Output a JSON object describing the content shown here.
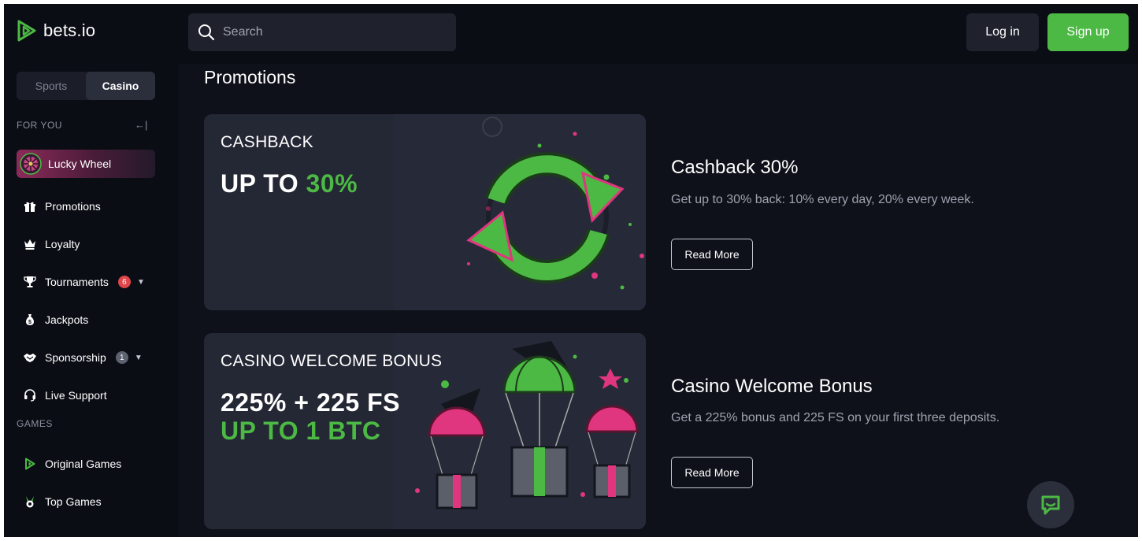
{
  "brand": {
    "name": "bets.io",
    "accent": "#4cb944"
  },
  "header": {
    "search": {
      "placeholder": "Search",
      "icon": "search-icon"
    },
    "login_label": "Log in",
    "signup_label": "Sign up"
  },
  "sidebar": {
    "mode_tabs": [
      {
        "label": "Sports",
        "active": false
      },
      {
        "label": "Casino",
        "active": true
      }
    ],
    "for_you_label": "FOR YOU",
    "collapse_glyph": "←|",
    "featured": {
      "label": "Lucky Wheel",
      "icon": "lucky-wheel-icon"
    },
    "items": [
      {
        "label": "Promotions",
        "icon": "gift-icon"
      },
      {
        "label": "Loyalty",
        "icon": "crown-icon"
      },
      {
        "label": "Tournaments",
        "icon": "trophy-icon",
        "badge": "6",
        "badge_color": "#e0464a"
      },
      {
        "label": "Jackpots",
        "icon": "money-bag-icon"
      },
      {
        "label": "Sponsorship",
        "icon": "handshake-icon",
        "badge": "1",
        "badge_color": "#5d6270"
      },
      {
        "label": "Live Support",
        "icon": "headset-icon"
      }
    ],
    "games_label": "GAMES",
    "games": [
      {
        "label": "Original Games",
        "icon": "bets-logo-icon"
      },
      {
        "label": "Top Games",
        "icon": "medal-icon"
      }
    ]
  },
  "main": {
    "title": "Promotions",
    "promos": [
      {
        "banner_caption": "CASHBACK",
        "banner_line1_white": "UP TO ",
        "banner_line1_green": "30%",
        "title": "Cashback 30%",
        "description": "Get up to 30% back: 10% every day, 20% every week.",
        "button": "Read More"
      },
      {
        "banner_caption": "CASINO WELCOME BONUS",
        "banner_line1_white": "225% + 225 FS",
        "banner_line2_green": "UP TO 1 BTC",
        "title": "Casino Welcome Bonus",
        "description": "Get a 225% bonus and 225 FS on your first three deposits.",
        "button": "Read More"
      }
    ]
  },
  "chat": {
    "icon": "chat-icon"
  }
}
